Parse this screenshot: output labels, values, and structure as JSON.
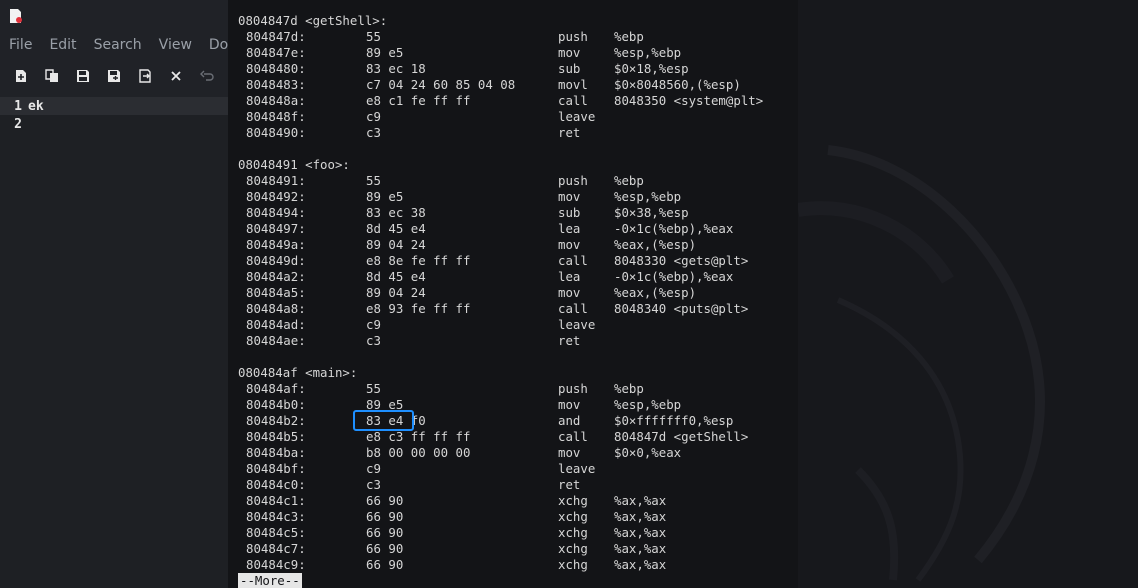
{
  "editor": {
    "menu": [
      "File",
      "Edit",
      "Search",
      "View",
      "Docu"
    ],
    "toolbar_icons": [
      "new-file-icon",
      "copy-icon",
      "save-icon",
      "save-as-icon",
      "export-icon",
      "close-icon",
      "undo-icon"
    ],
    "lines": [
      {
        "num": "1",
        "text": "ek"
      },
      {
        "num": "2",
        "text": ""
      }
    ]
  },
  "terminal": {
    "rows": [
      {
        "header": "0804847d <getShell>:"
      },
      {
        "addr": "804847d:",
        "bytes": "55",
        "op": "push",
        "args": "%ebp"
      },
      {
        "addr": "804847e:",
        "bytes": "89 e5",
        "op": "mov",
        "args": "%esp,%ebp"
      },
      {
        "addr": "8048480:",
        "bytes": "83 ec 18",
        "op": "sub",
        "args": "$0×18,%esp"
      },
      {
        "addr": "8048483:",
        "bytes": "c7 04 24 60 85 04 08",
        "op": "movl",
        "args": "$0×8048560,(%esp)"
      },
      {
        "addr": "804848a:",
        "bytes": "e8 c1 fe ff ff",
        "op": "call",
        "args": "8048350 <system@plt>"
      },
      {
        "addr": "804848f:",
        "bytes": "c9",
        "op": "leave",
        "args": ""
      },
      {
        "addr": "8048490:",
        "bytes": "c3",
        "op": "ret",
        "args": ""
      },
      {
        "blank": true
      },
      {
        "header": "08048491 <foo>:"
      },
      {
        "addr": "8048491:",
        "bytes": "55",
        "op": "push",
        "args": "%ebp"
      },
      {
        "addr": "8048492:",
        "bytes": "89 e5",
        "op": "mov",
        "args": "%esp,%ebp"
      },
      {
        "addr": "8048494:",
        "bytes": "83 ec 38",
        "op": "sub",
        "args": "$0×38,%esp"
      },
      {
        "addr": "8048497:",
        "bytes": "8d 45 e4",
        "op": "lea",
        "args": "-0×1c(%ebp),%eax"
      },
      {
        "addr": "804849a:",
        "bytes": "89 04 24",
        "op": "mov",
        "args": "%eax,(%esp)"
      },
      {
        "addr": "804849d:",
        "bytes": "e8 8e fe ff ff",
        "op": "call",
        "args": "8048330 <gets@plt>"
      },
      {
        "addr": "80484a2:",
        "bytes": "8d 45 e4",
        "op": "lea",
        "args": "-0×1c(%ebp),%eax"
      },
      {
        "addr": "80484a5:",
        "bytes": "89 04 24",
        "op": "mov",
        "args": "%eax,(%esp)"
      },
      {
        "addr": "80484a8:",
        "bytes": "e8 93 fe ff ff",
        "op": "call",
        "args": "8048340 <puts@plt>"
      },
      {
        "addr": "80484ad:",
        "bytes": "c9",
        "op": "leave",
        "args": ""
      },
      {
        "addr": "80484ae:",
        "bytes": "c3",
        "op": "ret",
        "args": ""
      },
      {
        "blank": true
      },
      {
        "header": "080484af <main>:"
      },
      {
        "addr": "80484af:",
        "bytes": "55",
        "op": "push",
        "args": "%ebp"
      },
      {
        "addr": "80484b0:",
        "bytes": "89 e5",
        "op": "mov",
        "args": "%esp,%ebp"
      },
      {
        "addr": "80484b2:",
        "bytes": "83 e4 f0",
        "op": "and",
        "args": "$0×fffffff0,%esp"
      },
      {
        "addr": "80484b5:",
        "bytes": "e8 c3 ff ff ff",
        "op": "call",
        "args": "804847d <getShell>"
      },
      {
        "addr": "80484ba:",
        "bytes": "b8 00 00 00 00",
        "op": "mov",
        "args": "$0×0,%eax"
      },
      {
        "addr": "80484bf:",
        "bytes": "c9",
        "op": "leave",
        "args": ""
      },
      {
        "addr": "80484c0:",
        "bytes": "c3",
        "op": "ret",
        "args": ""
      },
      {
        "addr": "80484c1:",
        "bytes": "66 90",
        "op": "xchg",
        "args": "%ax,%ax"
      },
      {
        "addr": "80484c3:",
        "bytes": "66 90",
        "op": "xchg",
        "args": "%ax,%ax"
      },
      {
        "addr": "80484c5:",
        "bytes": "66 90",
        "op": "xchg",
        "args": "%ax,%ax"
      },
      {
        "addr": "80484c7:",
        "bytes": "66 90",
        "op": "xchg",
        "args": "%ax,%ax"
      },
      {
        "addr": "80484c9:",
        "bytes": "66 90",
        "op": "xchg",
        "args": "%ax,%ax"
      }
    ],
    "more_prompt": "--More--"
  },
  "colors": {
    "terminal_bg": "#131417",
    "terminal_text": "#d6d6d6",
    "highlight": "#1e8fff",
    "editor_bg": "#202227"
  }
}
